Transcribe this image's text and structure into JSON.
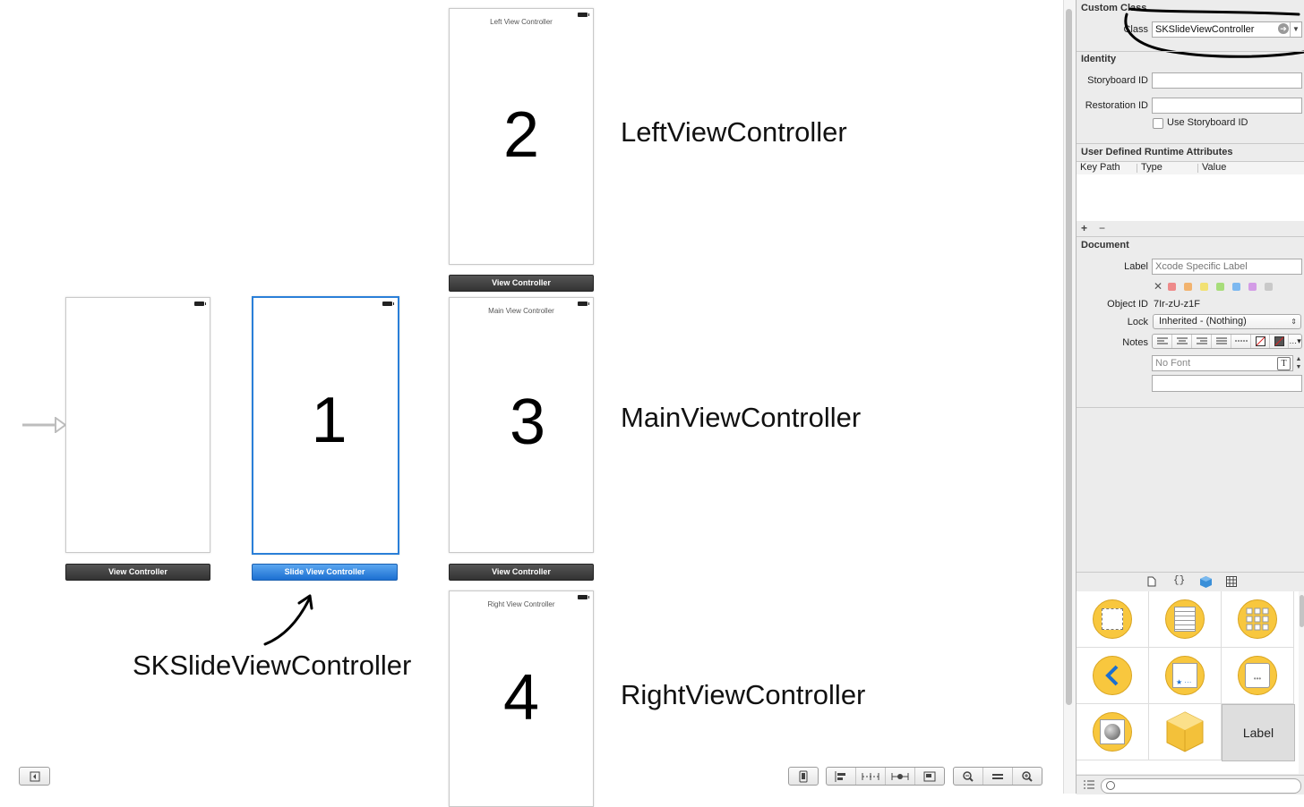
{
  "canvas": {
    "scenes": {
      "left": {
        "title": "Left View Controller",
        "number": "2",
        "dock_label": "View Controller"
      },
      "main": {
        "title": "Main View Controller",
        "number": "3",
        "dock_label": "View Controller"
      },
      "right": {
        "title": "Right View Controller",
        "number": "4"
      },
      "initial": {
        "dock_label": "View Controller"
      },
      "slide": {
        "number": "1",
        "dock_label": "Slide View Controller"
      }
    },
    "annotations": {
      "left": "LeftViewController",
      "main": "MainViewController",
      "right": "RightViewController",
      "slide": "SKSlideViewController"
    }
  },
  "inspector": {
    "custom_class": {
      "header": "Custom Class",
      "class_label": "Class",
      "class_value": "SKSlideViewController"
    },
    "identity": {
      "header": "Identity",
      "storyboard_id_label": "Storyboard ID",
      "restoration_id_label": "Restoration ID",
      "use_storyboard_id_label": "Use Storyboard ID"
    },
    "runtime_attrs": {
      "header": "User Defined Runtime Attributes",
      "columns": [
        "Key Path",
        "Type",
        "Value"
      ],
      "add": "+",
      "remove": "−"
    },
    "document": {
      "header": "Document",
      "label_label": "Label",
      "label_placeholder": "Xcode Specific Label",
      "object_id_label": "Object ID",
      "object_id_value": "7Ir-zU-z1F",
      "lock_label": "Lock",
      "lock_value": "Inherited - (Nothing)",
      "notes_label": "Notes",
      "font_placeholder": "No Font",
      "swatch_colors": [
        "#ee8a8a",
        "#f2b36e",
        "#f2e173",
        "#a7dd7a",
        "#7cb8f0",
        "#d39ce6",
        "#c9c9c9"
      ]
    },
    "library": {
      "label_item": "Label"
    }
  }
}
